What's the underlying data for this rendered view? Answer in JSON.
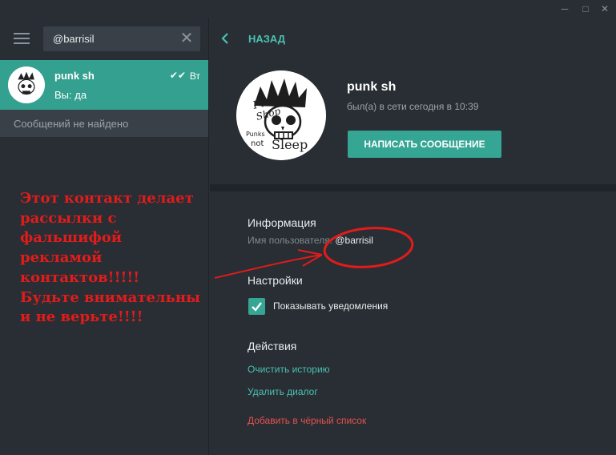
{
  "window": {
    "minimize_glyph": "─",
    "maximize_glyph": "□",
    "close_glyph": "✕"
  },
  "search": {
    "query": "@barrisil",
    "clear_glyph": "✕"
  },
  "chat_list": {
    "items": [
      {
        "name": "punk sh",
        "time": "Вт",
        "read_check": "✔✔",
        "preview": "Вы: да"
      }
    ],
    "empty_text": "Сообщений не найдено"
  },
  "annotation": {
    "warning_text": "Этот контакт делает\nрассылки с\nфальшифой\nрекламой\nконтактов!!!!!\nБудьте внимательны\nи не верьте!!!!",
    "color": "#e21b1b"
  },
  "profile": {
    "back_label": "НАЗАД",
    "name": "punk sh",
    "status": "был(а) в сети сегодня в 10:39",
    "write_button": "НАПИСАТЬ СООБЩЕНИЕ",
    "avatar_lettering": [
      "Punk",
      "Shop",
      "Punks",
      "not",
      "Sleep"
    ]
  },
  "info": {
    "title": "Информация",
    "username_label": "Имя пользователя:",
    "username_value": "@barrisil"
  },
  "settings": {
    "title": "Настройки",
    "notifications_label": "Показывать уведомления",
    "notifications_enabled": true
  },
  "actions": {
    "title": "Действия",
    "clear_history": "Очистить историю",
    "delete_dialog": "Удалить диалог",
    "block": "Добавить в чёрный список"
  },
  "colors": {
    "accent": "#35a594",
    "link": "#4bc0b2",
    "danger": "#e85050",
    "background": "#282e33"
  }
}
